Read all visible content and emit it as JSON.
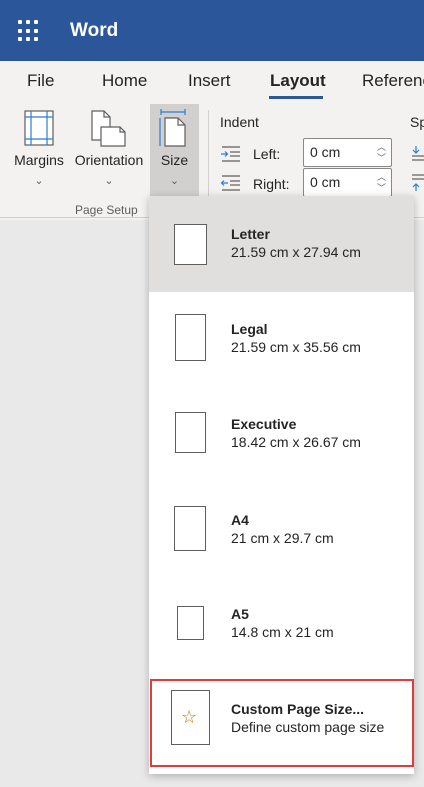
{
  "app": {
    "name": "Word"
  },
  "tabs": [
    "File",
    "Home",
    "Insert",
    "Layout",
    "Referenc"
  ],
  "active_tab": "Layout",
  "ribbon": {
    "page_setup": {
      "margins_label": "Margins",
      "orientation_label": "Orientation",
      "size_label": "Size",
      "group_label": "Page Setup"
    },
    "paragraph": {
      "indent_title": "Indent",
      "left_label": "Left:",
      "left_value": "0 cm",
      "right_label": "Right:",
      "right_value": "0 cm",
      "spacing_title": "Sp"
    }
  },
  "size_menu": {
    "items": [
      {
        "title": "Letter",
        "subtitle": "21.59 cm x 27.94 cm",
        "selected": true
      },
      {
        "title": "Legal",
        "subtitle": "21.59 cm x 35.56 cm",
        "selected": false
      },
      {
        "title": "Executive",
        "subtitle": "18.42 cm x 26.67 cm",
        "selected": false
      },
      {
        "title": "A4",
        "subtitle": "21 cm x 29.7 cm",
        "selected": false
      },
      {
        "title": "A5",
        "subtitle": "14.8 cm x 21 cm",
        "selected": false
      }
    ],
    "custom": {
      "title": "Custom Page Size...",
      "subtitle": "Define custom page size"
    }
  },
  "colors": {
    "brand": "#2b579a",
    "highlight_border": "#e03c3c",
    "star": "#d47500"
  },
  "icons": [
    "app-launcher-icon",
    "margins-icon",
    "orientation-icon",
    "size-icon",
    "indent-left-icon",
    "indent-right-icon",
    "star-icon",
    "chevron-down-icon"
  ]
}
